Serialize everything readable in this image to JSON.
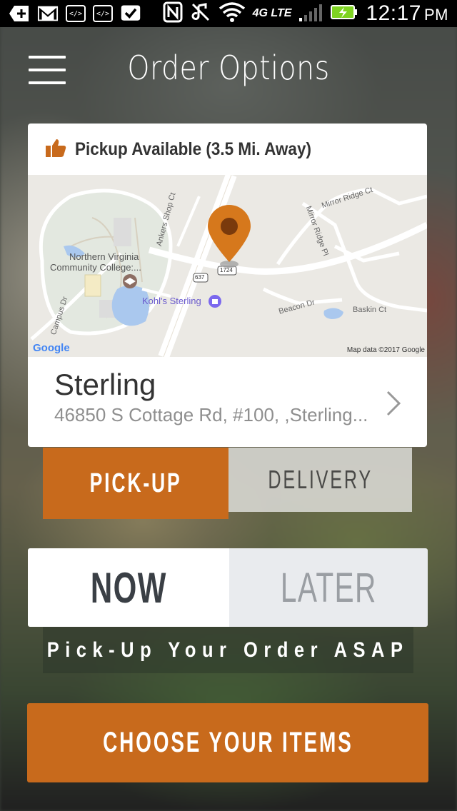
{
  "status_bar": {
    "time": "12:17",
    "ampm": "PM",
    "network": "4G LTE"
  },
  "header": {
    "title": "Order Options"
  },
  "location_card": {
    "availability": "Pickup Available (3.5 Mi. Away)",
    "store_name": "Sterling",
    "address": "46850 S Cottage Rd, #100, ,Sterling...",
    "map": {
      "labels": {
        "college_1": "Northern Virginia",
        "college_2": "Community College:...",
        "ankers": "Ankers Shop Ct",
        "kohls": "Kohl's Sterling",
        "mirror_ridge_ct": "Mirror Ridge Ct",
        "mirror_ridge_pl": "Mirror Ridge Pl",
        "beacon": "Beacon Dr",
        "baskin": "Baskin Ct",
        "campus": "Campus Dr",
        "route_637": "637",
        "route_1724": "1724",
        "google": "Google",
        "attribution": "Map data ©2017 Google"
      }
    }
  },
  "order_method": {
    "pickup": "PICK-UP",
    "delivery": "DELIVERY",
    "selected": "pickup"
  },
  "order_time": {
    "now": "NOW",
    "later": "LATER",
    "selected": "now",
    "message": "Pick-Up Your Order ASAP"
  },
  "cta": {
    "label": "CHOOSE YOUR ITEMS"
  },
  "colors": {
    "accent": "#c86a1c",
    "map_pin": "#d6781c"
  }
}
